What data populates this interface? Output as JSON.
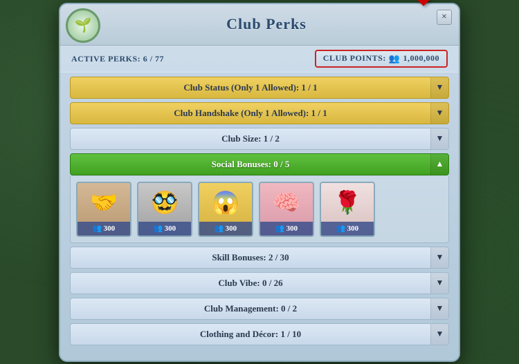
{
  "modal": {
    "title": "Club Perks",
    "close_label": "×"
  },
  "club_icon": "🌱",
  "arrow_indicator": "⬇",
  "stats": {
    "active_perks_label": "Active Perks:",
    "active_perks_value": "6 / 77",
    "club_points_label": "Club Points:",
    "club_points_value": "1,000,000",
    "people_icon": "👥"
  },
  "perk_rows": [
    {
      "id": "club-status",
      "label": "Club Status (Only 1 Allowed): 1 / 1",
      "style": "gold",
      "arrow": "▼",
      "expanded": false
    },
    {
      "id": "club-handshake",
      "label": "Club Handshake (Only 1 Allowed): 1 / 1",
      "style": "gold",
      "arrow": "▼",
      "expanded": false
    },
    {
      "id": "club-size",
      "label": "Club Size: 1 / 2",
      "style": "default",
      "arrow": "▼",
      "expanded": false
    },
    {
      "id": "social-bonuses",
      "label": "Social Bonuses: 0 / 5",
      "style": "green",
      "arrow": "▲",
      "expanded": true
    },
    {
      "id": "skill-bonuses",
      "label": "Skill Bonuses: 2 / 30",
      "style": "default",
      "arrow": "▼",
      "expanded": false
    },
    {
      "id": "club-vibe",
      "label": "Club Vibe: 0 / 26",
      "style": "default",
      "arrow": "▼",
      "expanded": false
    },
    {
      "id": "club-management",
      "label": "Club Management: 0 / 2",
      "style": "default",
      "arrow": "▼",
      "expanded": false
    },
    {
      "id": "clothing-decor",
      "label": "Clothing and Décor: 1 / 10",
      "style": "default",
      "arrow": "▼",
      "expanded": false
    }
  ],
  "social_bonus_items": [
    {
      "id": "handshake",
      "icon": "🤝",
      "cost": "300",
      "bg": "#d4b896"
    },
    {
      "id": "glasses",
      "icon": "🥸",
      "cost": "300",
      "bg": "#c0c0c0"
    },
    {
      "id": "mouth",
      "icon": "😱",
      "cost": "300",
      "bg": "#f0d060"
    },
    {
      "id": "brain",
      "icon": "🧠",
      "cost": "300",
      "bg": "#f0b8c0"
    },
    {
      "id": "rose",
      "icon": "🌹",
      "cost": "300",
      "bg": "#f0e0e0"
    }
  ]
}
